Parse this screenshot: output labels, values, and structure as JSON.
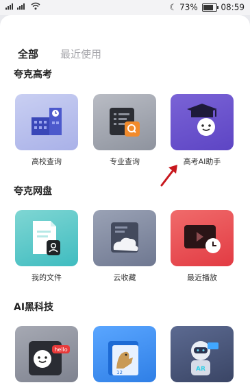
{
  "status_bar": {
    "signal_left": "1ᵢₗ 4ᴳᵢₗ",
    "battery_percent": "73%",
    "time": "08:59",
    "icons": [
      "signal-icon",
      "wifi-icon",
      "moon-icon",
      "battery-icon"
    ]
  },
  "tabs": [
    {
      "label": "全部",
      "active": true
    },
    {
      "label": "最近使用",
      "active": false
    }
  ],
  "sections": [
    {
      "title": "夸克高考",
      "items": [
        {
          "label": "高校查询",
          "icon": "university-building-icon"
        },
        {
          "label": "专业查询",
          "icon": "major-search-icon"
        },
        {
          "label": "高考AI助手",
          "icon": "ai-graduate-assistant-icon"
        }
      ]
    },
    {
      "title": "夸克网盘",
      "items": [
        {
          "label": "我的文件",
          "icon": "my-files-icon"
        },
        {
          "label": "云收藏",
          "icon": "cloud-favorites-icon"
        },
        {
          "label": "最近播放",
          "icon": "recent-playback-icon"
        }
      ]
    },
    {
      "title": "AI黑科技",
      "items": [
        {
          "label": "",
          "icon": "hello-bot-icon",
          "badge": "hello"
        },
        {
          "label": "",
          "icon": "photo-album-icon",
          "badge": "12"
        },
        {
          "label": "",
          "icon": "ar-robot-icon",
          "badge": "AR"
        }
      ]
    }
  ],
  "annotation": {
    "icon": "red-arrow-icon",
    "color": "#c8181e"
  }
}
